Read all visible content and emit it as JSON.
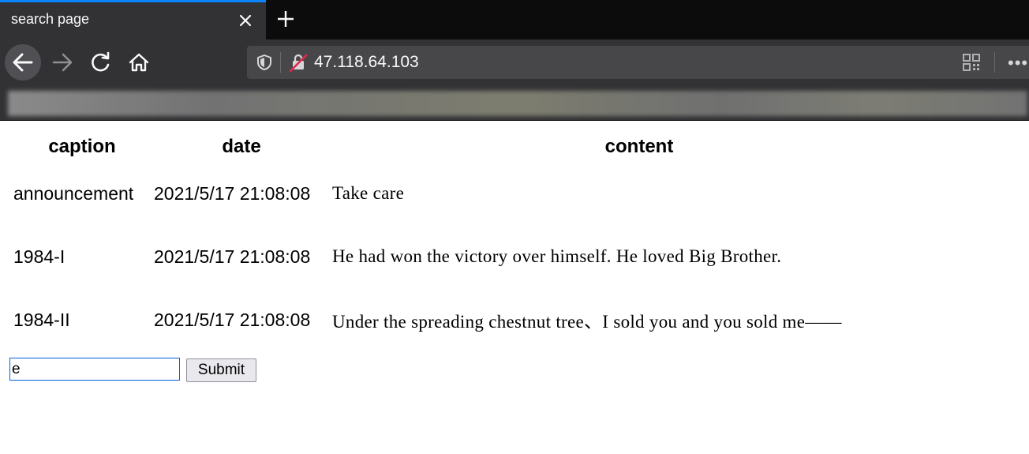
{
  "browser": {
    "tab_title": "search page",
    "url": "47.118.64.103"
  },
  "table": {
    "headers": [
      "caption",
      "date",
      "content"
    ],
    "rows": [
      {
        "caption": "announcement",
        "date": "2021/5/17 21:08:08",
        "content": "Take care"
      },
      {
        "caption": "1984-I",
        "date": "2021/5/17 21:08:08",
        "content": "He had won the victory over himself. He loved Big Brother."
      },
      {
        "caption": "1984-II",
        "date": "2021/5/17 21:08:08",
        "content": "Under the spreading chestnut tree、I sold you and you sold me——"
      }
    ]
  },
  "form": {
    "input_value": "e",
    "submit_label": "Submit"
  },
  "icons": [
    "close-icon",
    "plus-icon",
    "back-arrow-icon",
    "forward-arrow-icon",
    "reload-icon",
    "home-icon",
    "shield-icon",
    "insecure-lock-icon",
    "qr-code-icon",
    "more-icon"
  ],
  "colors": {
    "tab_accent": "#0a84ff",
    "chrome_bg": "#323234",
    "input_focus": "#0060df"
  }
}
